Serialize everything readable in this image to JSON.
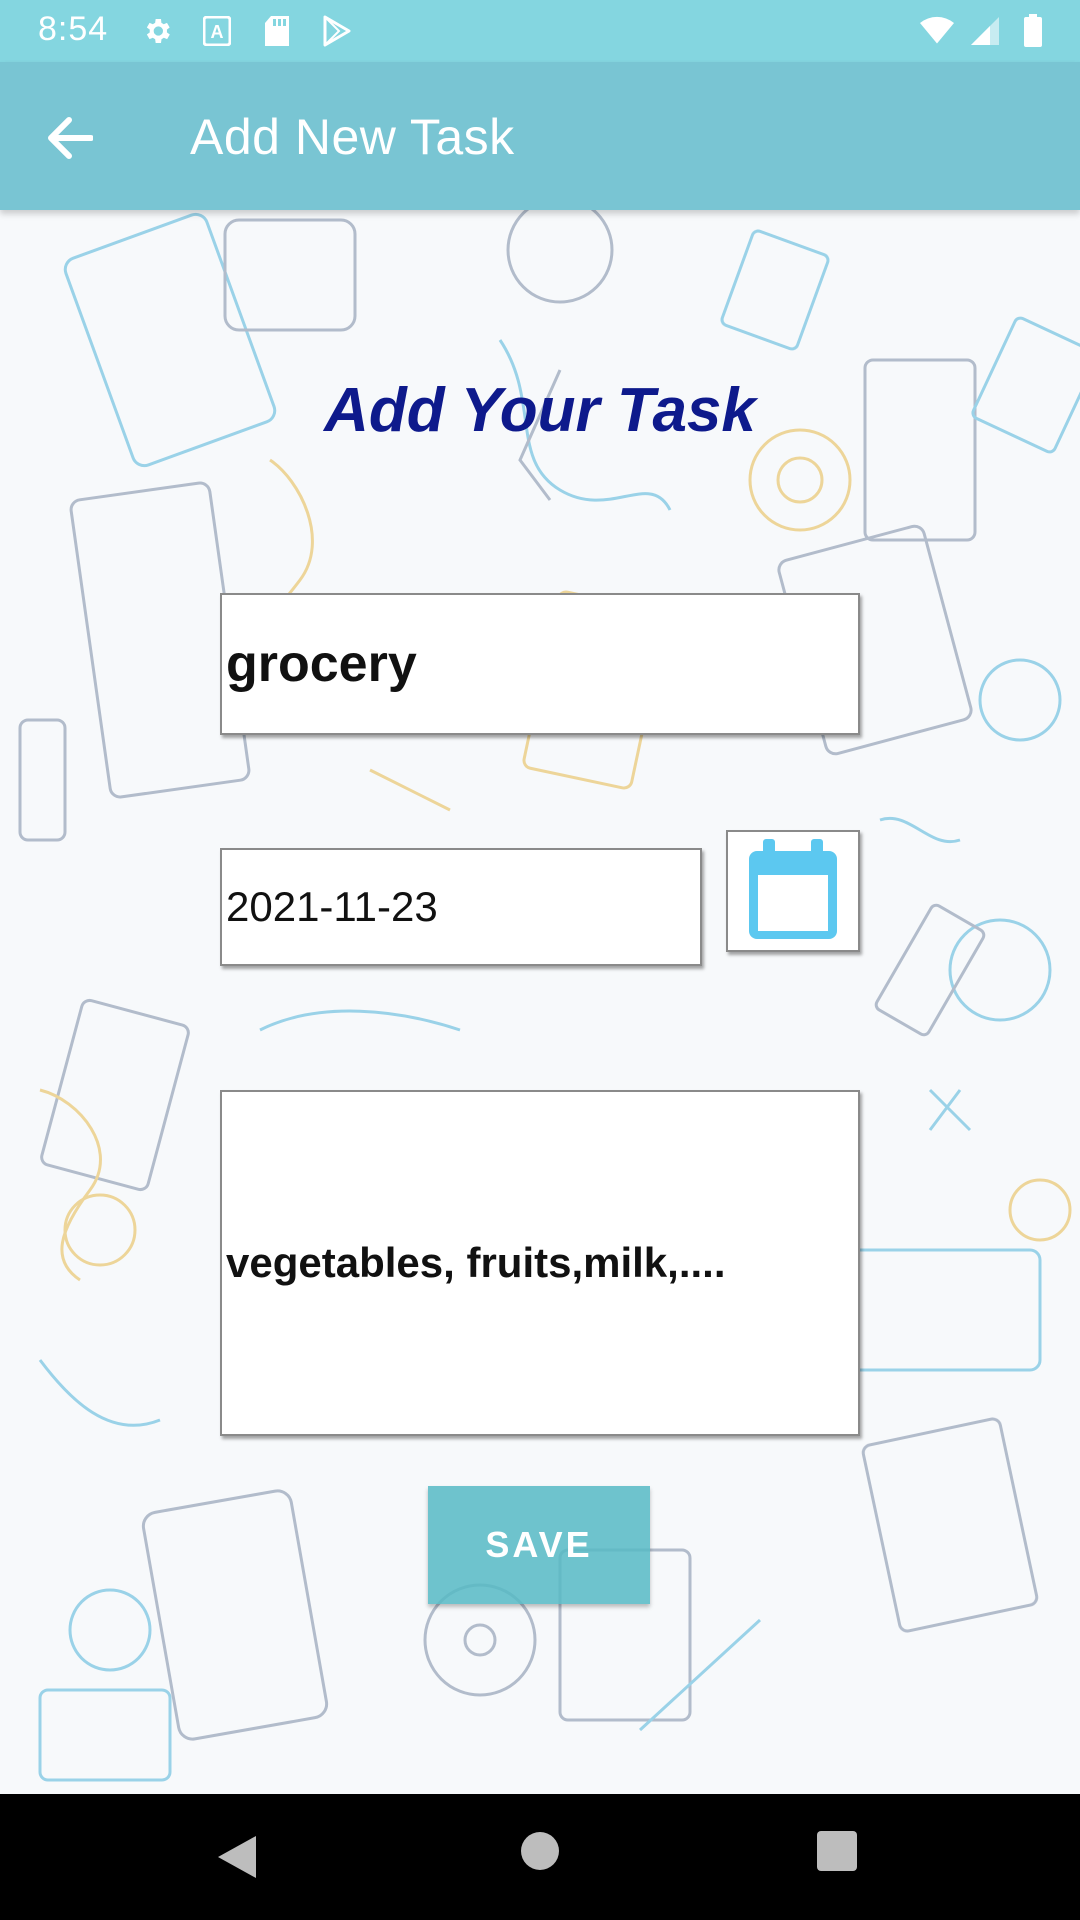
{
  "status_bar": {
    "time": "8:54",
    "left_icons": [
      "settings-icon",
      "font-a-icon",
      "sd-card-icon",
      "play-store-icon"
    ],
    "right_icons": [
      "wifi-icon",
      "signal-icon",
      "battery-icon"
    ]
  },
  "app_bar": {
    "back_icon": "arrow-left-icon",
    "title": "Add New Task"
  },
  "form": {
    "heading": "Add Your Task",
    "title_value": "grocery",
    "date_value": "2021-11-23",
    "calendar_icon": "calendar-icon",
    "description_value": "vegetables, fruits,milk,....",
    "save_label": "SAVE"
  },
  "nav_bar": {
    "icons": [
      "back-triangle-icon",
      "home-circle-icon",
      "recents-square-icon"
    ]
  },
  "colors": {
    "status_bar": "#84d6e0",
    "app_bar": "#79c5d3",
    "heading": "#0e1a8c",
    "save_button": "#56bac4",
    "calendar": "#5cc8f0"
  }
}
